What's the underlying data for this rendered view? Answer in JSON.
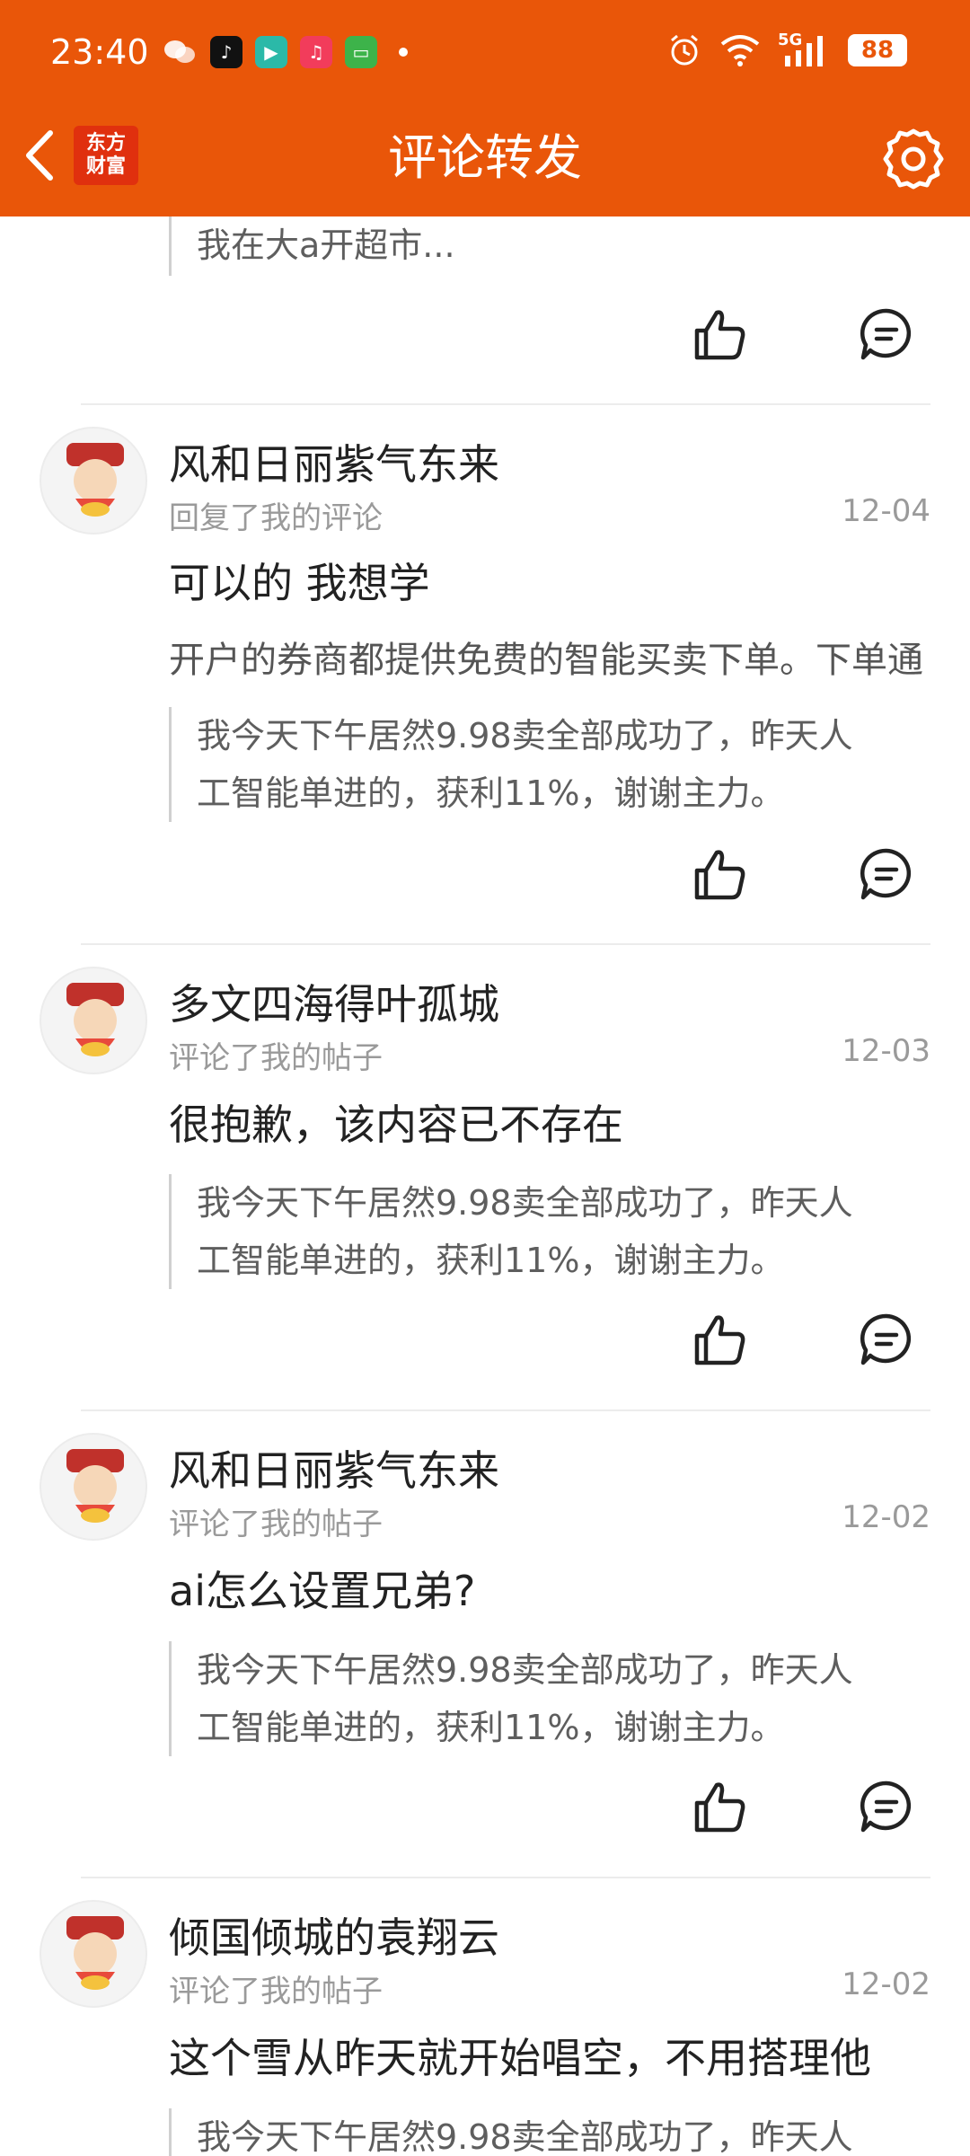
{
  "status_bar": {
    "time": "23:40",
    "network": "5G",
    "battery": "88",
    "apps": [
      "wechat-icon",
      "tiktok-icon",
      "video-icon",
      "music-icon",
      "message-icon"
    ]
  },
  "header": {
    "title": "评论转发",
    "logo_line1": "东方",
    "logo_line2": "财富",
    "brand_color": "#E95609"
  },
  "top_partial": {
    "quote": "我在大a开超市..."
  },
  "items": [
    {
      "username": "风和日丽紫气东来",
      "action": "回复了我的评论",
      "date": "12-04",
      "comment": "可以的  我想学",
      "extra": "开户的券商都提供免费的智能买卖下单。下单通",
      "quote_line1": "我今天下午居然9.98卖全部成功了，昨天人",
      "quote_line2": "工智能单进的，获利11%，谢谢主力。"
    },
    {
      "username": "多文四海得叶孤城",
      "action": "评论了我的帖子",
      "date": "12-03",
      "comment": " 很抱歉，该内容已不存在",
      "quote_line1": "我今天下午居然9.98卖全部成功了，昨天人",
      "quote_line2": "工智能单进的，获利11%，谢谢主力。"
    },
    {
      "username": "风和日丽紫气东来",
      "action": "评论了我的帖子",
      "date": "12-02",
      "comment": "ai怎么设置兄弟?",
      "quote_line1": "我今天下午居然9.98卖全部成功了，昨天人",
      "quote_line2": "工智能单进的，获利11%，谢谢主力。"
    },
    {
      "username": "倾国倾城的袁翔云",
      "action": "评论了我的帖子",
      "date": "12-02",
      "comment": "这个雪从昨天就开始唱空，不用搭理他",
      "quote_line1": "我今天下午居然9.98卖全部成功了，昨天人"
    }
  ]
}
